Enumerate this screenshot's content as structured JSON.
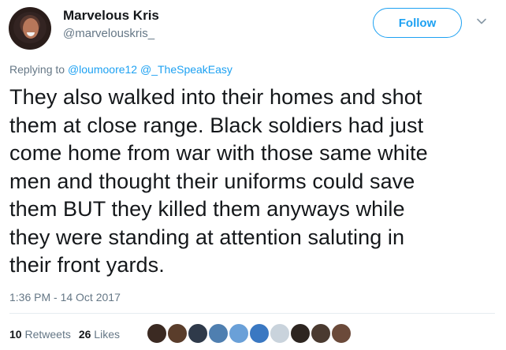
{
  "tweet": {
    "display_name": "Marvelous Kris",
    "handle": "@marvelouskris_",
    "follow_label": "Follow",
    "reply_prefix": "Replying to",
    "reply_mentions": [
      "@loumoore12",
      "@_TheSpeakEasy"
    ],
    "text_lines": [
      "They also walked into their homes and shot",
      "them at close range. Black soldiers had just",
      "come home from war with those same white",
      "men and thought their uniforms could save",
      "them BUT they killed them anyways while",
      "they were standing at attention saluting in",
      "their front yards."
    ],
    "timestamp": "1:36 PM - 14 Oct 2017",
    "stats": {
      "retweets_count": "10",
      "retweets_label": "Retweets",
      "likes_count": "26",
      "likes_label": "Likes"
    }
  },
  "colors": {
    "accent": "#1da1f2",
    "text_primary": "#14171a",
    "text_secondary": "#657786",
    "divider": "#e6ecf0"
  },
  "liker_avatars": [
    {
      "name": "liker-avatar-1",
      "color": "#3b2a22"
    },
    {
      "name": "liker-avatar-2",
      "color": "#5a3d2b"
    },
    {
      "name": "liker-avatar-3",
      "color": "#2f3a4a"
    },
    {
      "name": "liker-avatar-4",
      "color": "#4f7fb0"
    },
    {
      "name": "liker-avatar-5",
      "color": "#6aa0d8"
    },
    {
      "name": "liker-avatar-6",
      "color": "#3a78c2"
    },
    {
      "name": "liker-avatar-7",
      "color": "#c9d3dc"
    },
    {
      "name": "liker-avatar-8",
      "color": "#2d2520"
    },
    {
      "name": "liker-avatar-9",
      "color": "#4a3a30"
    },
    {
      "name": "liker-avatar-10",
      "color": "#6b4a3a"
    }
  ]
}
